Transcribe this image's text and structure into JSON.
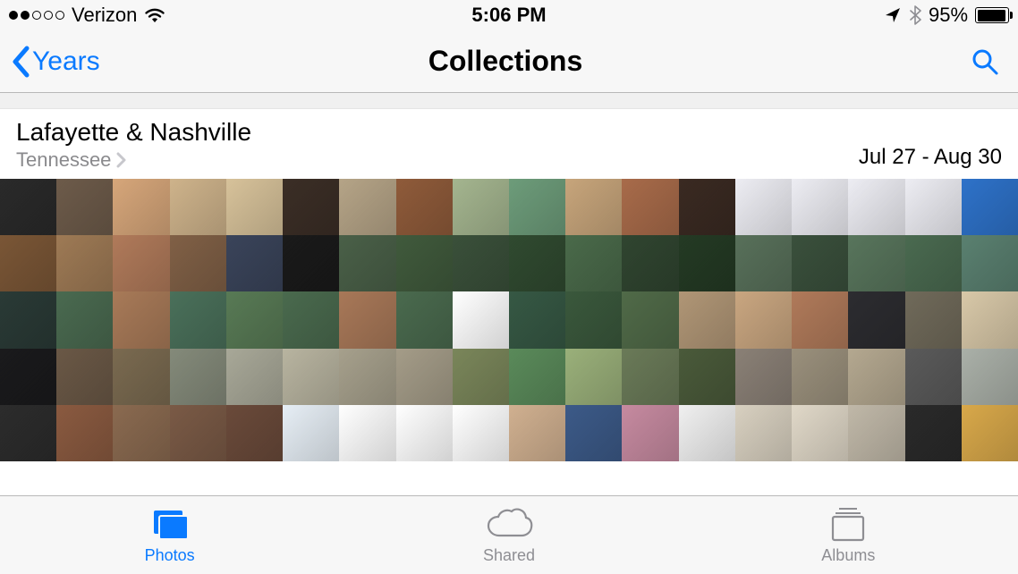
{
  "status_bar": {
    "carrier": "Verizon",
    "signal_filled": 2,
    "signal_total": 5,
    "wifi": true,
    "time": "5:06 PM",
    "location_services": true,
    "bluetooth": true,
    "battery_percent_label": "95%",
    "battery_fill_percent": 95
  },
  "nav": {
    "back_label": "Years",
    "title": "Collections"
  },
  "section": {
    "location_title": "Lafayette & Nashville",
    "location_subtitle": "Tennessee",
    "date_range": "Jul 27 - Aug 30"
  },
  "grid": {
    "columns": 18,
    "rows": 5,
    "row_colors": [
      [
        "#2a2a2a",
        "#6d5b4a",
        "#d6a67a",
        "#ceb38b",
        "#d7c29a",
        "#3b2e26",
        "#b5a487",
        "#8f5b3a",
        "#a4b58f",
        "#6d9c7a",
        "#c7a57b",
        "#a86b4a",
        "#3a2a22",
        "#ededf3",
        "#ededf3",
        "#ededf3",
        "#ededf3",
        "#2e72c9"
      ],
      [
        "#7a5636",
        "#9e7a55",
        "#b07a5a",
        "#806046",
        "#3a445a",
        "#1a1a1a",
        "#4a6048",
        "#405a3c",
        "#3a503a",
        "#304a30",
        "#4a6a4a",
        "#304530",
        "#243a24",
        "#58705a",
        "#3a503c",
        "#58755c",
        "#4a6a50",
        "#5a8070"
      ],
      [
        "#2a3a36",
        "#4a6a50",
        "#a87a58",
        "#4a705a",
        "#587a55",
        "#4a6a4e",
        "#a87858",
        "#4a6a4e",
        "#ffffff",
        "#365844",
        "#3a583c",
        "#506a48",
        "#b09676",
        "#c9a680",
        "#b07a5a",
        "#2c2c30",
        "#706a5a",
        "#d8c8a8"
      ],
      [
        "#1a1a1c",
        "#6a5846",
        "#7a6a50",
        "#848a7a",
        "#a8a898",
        "#b8b4a0",
        "#a6a08c",
        "#a49c88",
        "#7a865a",
        "#5a8a5a",
        "#9ab07a",
        "#6a7a58",
        "#4a5a3a",
        "#8a8076",
        "#9a907c",
        "#b4a890",
        "#5a5a5a",
        "#aab0a8"
      ],
      [
        "#2c2c2c",
        "#8a5a40",
        "#8a6a50",
        "#7a5a46",
        "#6a4a3a",
        "#e6eef5",
        "#ffffff",
        "#ffffff",
        "#ffffff",
        "#d0b090",
        "#3c5a88",
        "#c68aa0",
        "#f0f0f0",
        "#d8d0c0",
        "#e0d8c8",
        "#c0b8a8",
        "#2a2a2a",
        "#d8a84a"
      ]
    ]
  },
  "tabs": {
    "items": [
      {
        "label": "Photos",
        "selected": true
      },
      {
        "label": "Shared",
        "selected": false
      },
      {
        "label": "Albums",
        "selected": false
      }
    ]
  }
}
